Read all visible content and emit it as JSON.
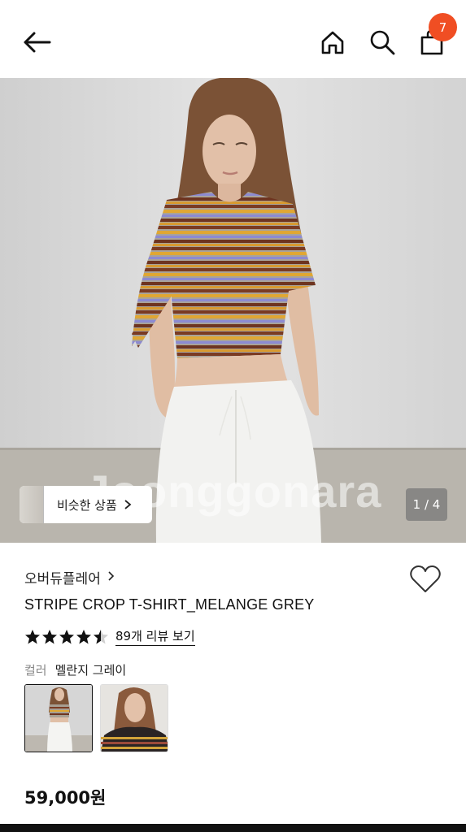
{
  "header": {
    "back_icon": "arrow-left-icon",
    "home_icon": "home-icon",
    "search_icon": "search-icon",
    "bag_icon": "shopping-bag-icon",
    "cart_count": "7",
    "badge_color": "#f04e23"
  },
  "gallery": {
    "watermark": "Joonggonara",
    "similar_label": "비슷한 상품",
    "page_indicator": "1 / 4"
  },
  "product": {
    "brand": "오버듀플레어",
    "title": "STRIPE CROP T-SHIRT_MELANGE GREY",
    "rating": 4.5,
    "review_link": "89개 리뷰 보기",
    "color_label": "컬러",
    "color_value": "멜란지 그레이",
    "color_options": [
      "멜란지 그레이",
      "black stripe"
    ],
    "selected_color_index": 0,
    "price": "59,000원"
  }
}
